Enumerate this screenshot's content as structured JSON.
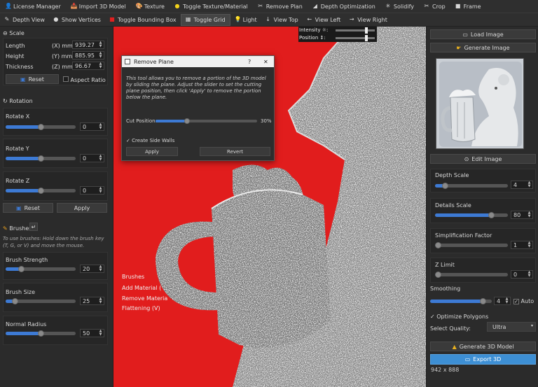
{
  "menubar": [
    {
      "icon": "person-icon",
      "glyph": "👤",
      "label": "License Manager"
    },
    {
      "icon": "import-icon",
      "glyph": "📥",
      "label": "Import 3D Model"
    },
    {
      "icon": "texture-icon",
      "glyph": "🎨",
      "label": "Texture"
    },
    {
      "icon": "toggle-texture-icon",
      "glyph": "●",
      "label": "Toggle Texture/Material",
      "color": "#f2d21b"
    },
    {
      "icon": "remove-plane-icon",
      "glyph": "✂",
      "label": "Remove Plan"
    },
    {
      "icon": "depth-icon",
      "glyph": "◢",
      "label": "Depth Optimization"
    },
    {
      "icon": "solidify-icon",
      "glyph": "✳",
      "label": "Solidify"
    },
    {
      "icon": "crop-icon",
      "glyph": "✂",
      "label": "Crop"
    },
    {
      "icon": "frame-icon",
      "glyph": "■",
      "label": "Frame"
    }
  ],
  "toolbar": [
    {
      "icon": "depth-view-icon",
      "glyph": "✎",
      "label": "Depth View"
    },
    {
      "icon": "vertices-icon",
      "glyph": "●",
      "label": "Show Vertices"
    },
    {
      "icon": "bounding-box-icon",
      "glyph": "■",
      "label": "Toggle Bounding Box",
      "color": "#e02020"
    },
    {
      "icon": "grid-icon",
      "glyph": "▦",
      "label": "Toggle Grid",
      "active": true
    },
    {
      "icon": "light-icon",
      "glyph": "💡",
      "label": "Light"
    },
    {
      "icon": "arrow-down-icon",
      "glyph": "↓",
      "label": "View Top"
    },
    {
      "icon": "arrow-left-icon",
      "glyph": "←",
      "label": "View Left"
    },
    {
      "icon": "arrow-right-icon",
      "glyph": "→",
      "label": "View Right"
    }
  ],
  "scale": {
    "title": "Scale",
    "length_label": "Length",
    "length_unit": "(X) mm:",
    "length_value": "939.27",
    "height_label": "Height",
    "height_unit": "(Y) mm:",
    "height_value": "885.95",
    "thickness_label": "Thickness",
    "thickness_unit": "(Z) mm:",
    "thickness_value": "96.67",
    "reset_label": "Reset",
    "aspect_label": "Aspect Ratio"
  },
  "rotation": {
    "title": "Rotation",
    "x_label": "Rotate X",
    "x_value": "0",
    "x_level": 0.5,
    "y_label": "Rotate Y",
    "y_value": "0",
    "y_level": 0.5,
    "z_label": "Rotate Z",
    "z_value": "0",
    "z_level": 0.5,
    "reset_label": "Reset",
    "apply_label": "Apply"
  },
  "brushes": {
    "title": "Brushes",
    "hint": "To use brushes: Hold down the brush key (T, G, or V) and move the mouse.",
    "strength_label": "Brush Strength",
    "strength_value": "20",
    "strength_level": 0.2,
    "size_label": "Brush Size",
    "size_value": "25",
    "size_level": 0.1,
    "radius_label": "Normal Radius",
    "radius_value": "50",
    "radius_level": 0.5
  },
  "viewport_overlay": {
    "intensity_label": "Intensity ☼:",
    "position_label": "Position ↕:",
    "brushes_title": "Brushes",
    "add_material": "Add Material (",
    "remove_material": "Remove Materia",
    "flattening": "Flattening (V)"
  },
  "dialog": {
    "title": "Remove Plane",
    "help": "?",
    "close": "✕",
    "description": "This tool allows you to remove a portion of the 3D model by sliding the plane. Adjust the slider to set the cutting plane position, then click 'Apply' to remove the portion below the plane.",
    "cut_label": "Cut Position:",
    "cut_value": "30%",
    "cut_level": 0.3,
    "side_walls_label": "Create Side Walls",
    "apply_label": "Apply",
    "revert_label": "Revert"
  },
  "right_panel": {
    "load_label": "Load Image",
    "generate_label": "Generate Image",
    "edit_label": "Edit Image",
    "depth_label": "Depth Scale",
    "depth_value": "4",
    "depth_level": 0.1,
    "details_label": "Details Scale",
    "details_value": "80",
    "details_level": 0.8,
    "simp_label": "Simplification Factor",
    "simp_value": "1",
    "simp_level": 0.0,
    "zlimit_label": "Z Limit",
    "zlimit_value": "0",
    "zlimit_level": 0.0,
    "smoothing_label": "Smoothing",
    "smoothing_value": "4",
    "smoothing_level": 0.9,
    "auto_label": "Auto",
    "optimize_label": "Optimize Polygons",
    "quality_label": "Select Quality:",
    "quality_value": "Ultra",
    "generate3d_label": "Generate 3D Model",
    "export_label": "Export 3D",
    "dims": "942 x 888"
  }
}
